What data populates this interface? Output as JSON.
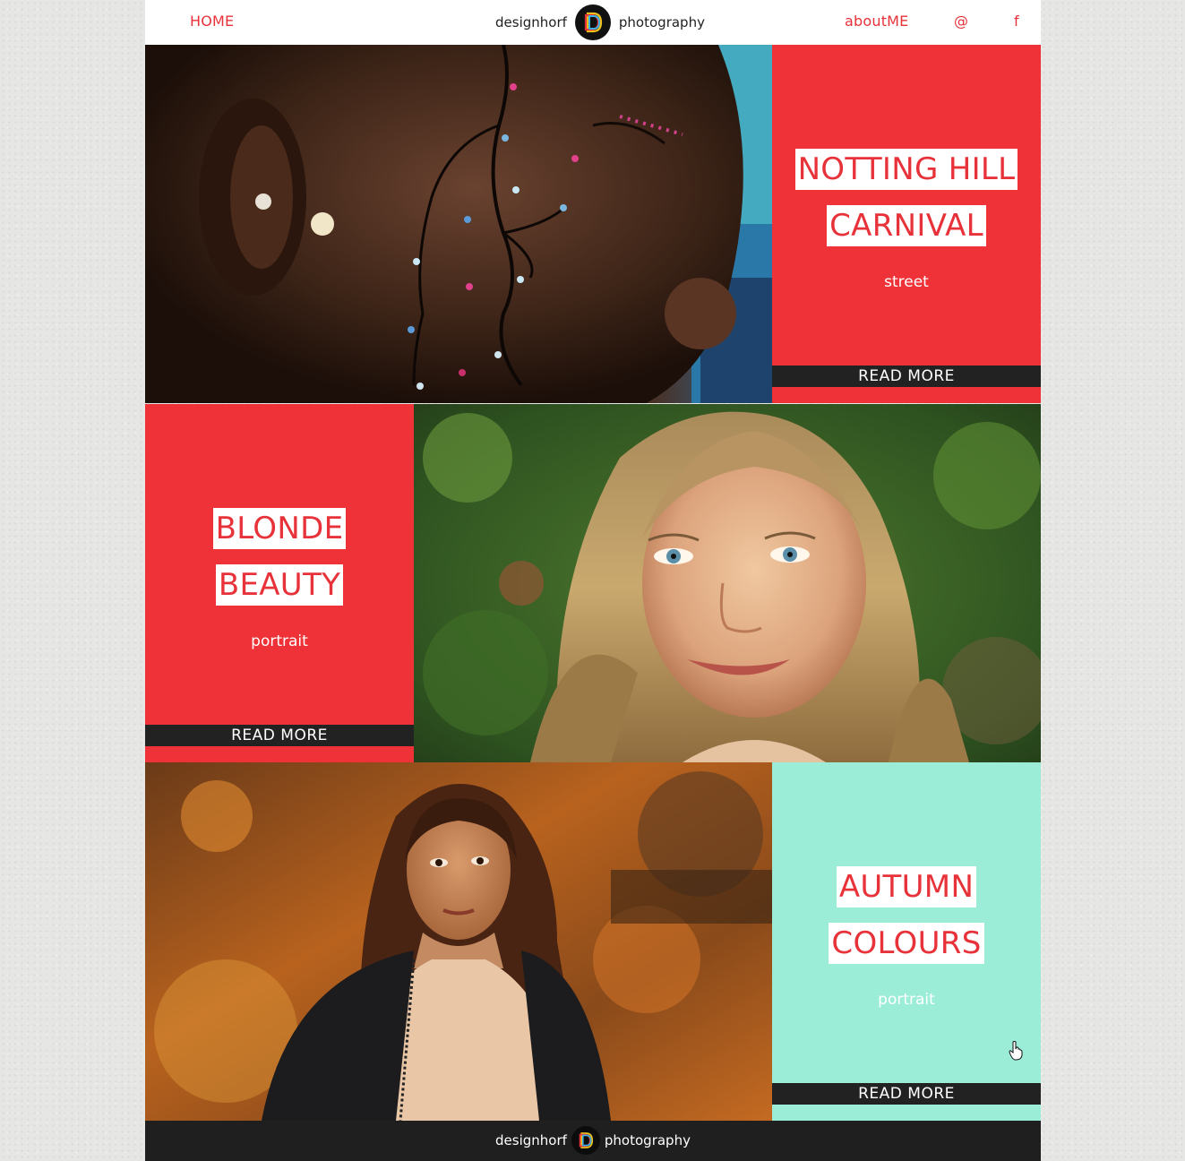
{
  "nav": {
    "home": "HOME",
    "brand_left": "designhorf",
    "brand_right": "photography",
    "about": "aboutME",
    "email": "@",
    "facebook": "f"
  },
  "posts": [
    {
      "title_line1": "NOTTING HILL",
      "title_line2": "CARNIVAL",
      "category": "street",
      "read_more": "READ MORE",
      "panel_color": "#ef3238"
    },
    {
      "title_line1": "BLONDE",
      "title_line2": "BEAUTY",
      "category": "portrait",
      "read_more": "READ MORE",
      "panel_color": "#ef3238"
    },
    {
      "title_line1": "AUTUMN",
      "title_line2": "COLOURS",
      "category": "portrait",
      "read_more": "READ MORE",
      "panel_color": "#9cedd8"
    }
  ],
  "footer": {
    "brand_left": "designhorf",
    "brand_right": "photography"
  },
  "colors": {
    "accent": "#e8323a",
    "dark": "#222222",
    "mint": "#9cedd8"
  }
}
